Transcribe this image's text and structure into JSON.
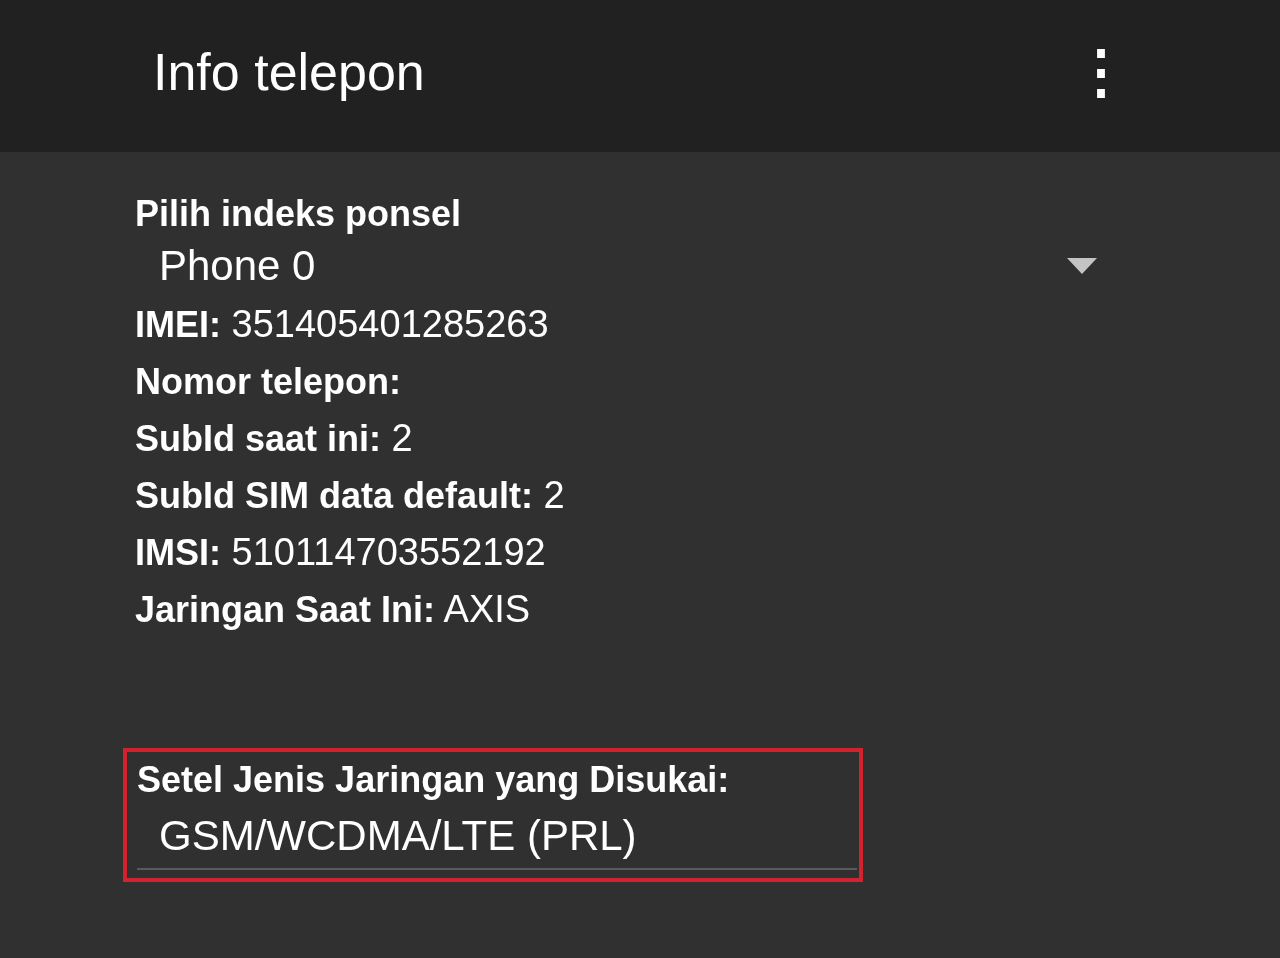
{
  "app_bar": {
    "title": "Info telepon",
    "menu_icon": "⋮"
  },
  "phone_index": {
    "label": "Pilih indeks ponsel",
    "value": "Phone 0"
  },
  "info": [
    {
      "text": "**IMEI:** 351405401285263"
    },
    {
      "text": "**Nomor telepon:**"
    },
    {
      "text": "**SubId saat ini:** 2"
    },
    {
      "text": "**SubId SIM data default:** 2"
    },
    {
      "text": "**IMSI:** 510114703552192"
    },
    {
      "text": "**Jaringan Saat Ini:** AXIS"
    }
  ],
  "preferred_network": {
    "label": "Setel Jenis Jaringan yang Disukai:",
    "value": "GSM/WCDMA/LTE (PRL)",
    "highlighted": true
  }
}
